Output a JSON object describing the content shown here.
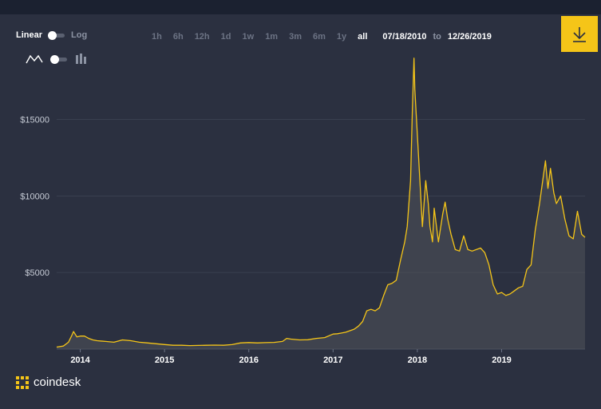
{
  "controls": {
    "scale": {
      "linear_label": "Linear",
      "log_label": "Log",
      "selected": "Linear"
    },
    "chart_type": {
      "line_icon": "line-chart-icon",
      "bars_icon": "candlestick-icon",
      "selected": "line"
    },
    "ranges": [
      "1h",
      "6h",
      "12h",
      "1d",
      "1w",
      "1m",
      "3m",
      "6m",
      "1y",
      "all"
    ],
    "selected_range": "all",
    "date_from": "07/18/2010",
    "date_to_label": "to",
    "date_to": "12/26/2019",
    "download_icon": "download-icon"
  },
  "brand": {
    "name": "coindesk",
    "icon": "coindesk-logo-icon"
  },
  "colors": {
    "line": "#f5c518",
    "accent": "#f5c518",
    "background": "#2b3040",
    "grid": "#3a4050"
  },
  "chart_data": {
    "type": "area",
    "xlabel": "",
    "ylabel": "",
    "ylim": [
      0,
      18000
    ],
    "xlim": [
      2013.72,
      2019.99
    ],
    "y_ticks": [
      5000,
      10000,
      15000
    ],
    "y_tick_labels": [
      "$5000",
      "$10000",
      "$15000"
    ],
    "x_ticks": [
      2014,
      2015,
      2016,
      2017,
      2018,
      2019
    ],
    "x_tick_labels": [
      "2014",
      "2015",
      "2016",
      "2017",
      "2018",
      "2019"
    ],
    "grid": true,
    "series": [
      {
        "x": [
          2013.72,
          2013.8,
          2013.86,
          2013.9,
          2013.92,
          2013.96,
          2014.0,
          2014.05,
          2014.1,
          2014.15,
          2014.2,
          2014.3,
          2014.4,
          2014.5,
          2014.6,
          2014.7,
          2014.8,
          2014.9,
          2015.0,
          2015.1,
          2015.2,
          2015.3,
          2015.4,
          2015.5,
          2015.6,
          2015.7,
          2015.8,
          2015.9,
          2016.0,
          2016.1,
          2016.2,
          2016.3,
          2016.4,
          2016.45,
          2016.5,
          2016.6,
          2016.7,
          2016.8,
          2016.9,
          2017.0,
          2017.05,
          2017.1,
          2017.15,
          2017.2,
          2017.25,
          2017.3,
          2017.35,
          2017.4,
          2017.45,
          2017.5,
          2017.55,
          2017.6,
          2017.65,
          2017.7,
          2017.75,
          2017.8,
          2017.85,
          2017.88,
          2017.9,
          2017.92,
          2017.94,
          2017.96,
          2017.97,
          2018.0,
          2018.03,
          2018.06,
          2018.1,
          2018.13,
          2018.15,
          2018.18,
          2018.2,
          2018.25,
          2018.3,
          2018.33,
          2018.36,
          2018.4,
          2018.45,
          2018.5,
          2018.55,
          2018.6,
          2018.65,
          2018.7,
          2018.75,
          2018.8,
          2018.85,
          2018.9,
          2018.95,
          2019.0,
          2019.05,
          2019.1,
          2019.15,
          2019.2,
          2019.25,
          2019.3,
          2019.35,
          2019.4,
          2019.45,
          2019.5,
          2019.52,
          2019.55,
          2019.58,
          2019.62,
          2019.65,
          2019.7,
          2019.75,
          2019.8,
          2019.85,
          2019.9,
          2019.95,
          2019.99
        ],
        "values": [
          130,
          200,
          450,
          900,
          1150,
          800,
          850,
          850,
          700,
          600,
          550,
          500,
          450,
          600,
          550,
          450,
          400,
          350,
          300,
          250,
          250,
          230,
          240,
          250,
          260,
          250,
          290,
          400,
          430,
          400,
          420,
          440,
          500,
          700,
          650,
          600,
          610,
          700,
          750,
          980,
          1000,
          1050,
          1100,
          1200,
          1300,
          1500,
          1800,
          2500,
          2600,
          2500,
          2700,
          3500,
          4200,
          4300,
          4500,
          5800,
          7000,
          8000,
          9500,
          11000,
          15500,
          19000,
          17000,
          14000,
          11000,
          8000,
          11000,
          9500,
          8000,
          7000,
          9200,
          7000,
          8800,
          9600,
          8500,
          7500,
          6500,
          6400,
          7400,
          6500,
          6400,
          6500,
          6600,
          6300,
          5500,
          4200,
          3600,
          3700,
          3500,
          3600,
          3800,
          4000,
          4100,
          5200,
          5500,
          7800,
          9500,
          11500,
          12300,
          10500,
          11800,
          10200,
          9500,
          10000,
          8500,
          7400,
          7200,
          9000,
          7500,
          7300
        ]
      }
    ]
  }
}
